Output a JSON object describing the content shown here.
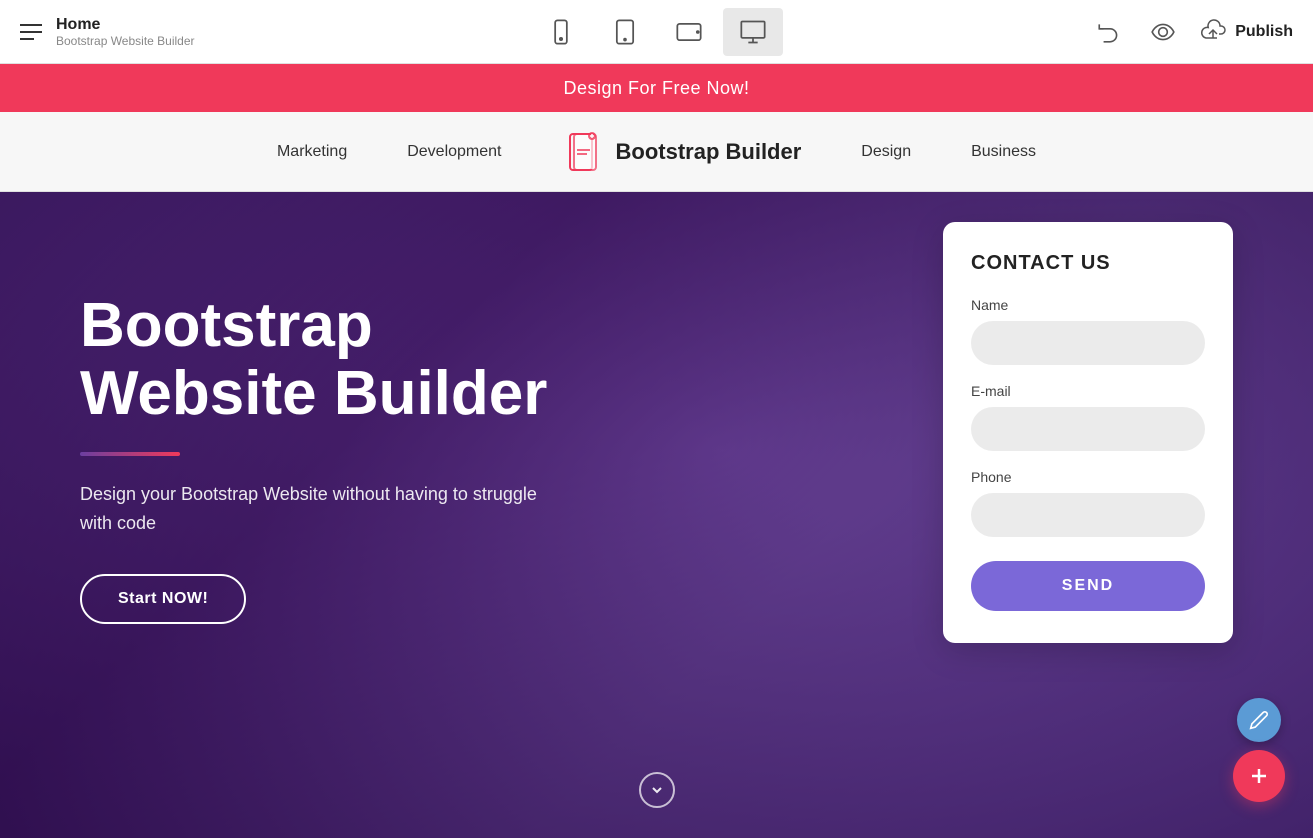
{
  "topbar": {
    "home_title": "Home",
    "home_subtitle": "Bootstrap Website Builder",
    "publish_label": "Publish"
  },
  "promo": {
    "text": "Design For Free Now!"
  },
  "nav": {
    "items": [
      {
        "label": "Marketing"
      },
      {
        "label": "Development"
      },
      {
        "label": "Design"
      },
      {
        "label": "Business"
      }
    ],
    "logo_text": "Bootstrap Builder"
  },
  "hero": {
    "title_line1": "Bootstrap",
    "title_line2": "Website Builder",
    "subtitle": "Design your Bootstrap Website without having to struggle with code",
    "cta_label": "Start NOW!"
  },
  "contact": {
    "title": "CONTACT US",
    "name_label": "Name",
    "name_placeholder": "",
    "email_label": "E-mail",
    "email_placeholder": "",
    "phone_label": "Phone",
    "phone_placeholder": "",
    "send_label": "SEND"
  },
  "devices": [
    {
      "name": "mobile",
      "label": "Mobile"
    },
    {
      "name": "tablet",
      "label": "Tablet"
    },
    {
      "name": "tablet-landscape",
      "label": "Tablet Landscape"
    },
    {
      "name": "desktop",
      "label": "Desktop"
    }
  ]
}
